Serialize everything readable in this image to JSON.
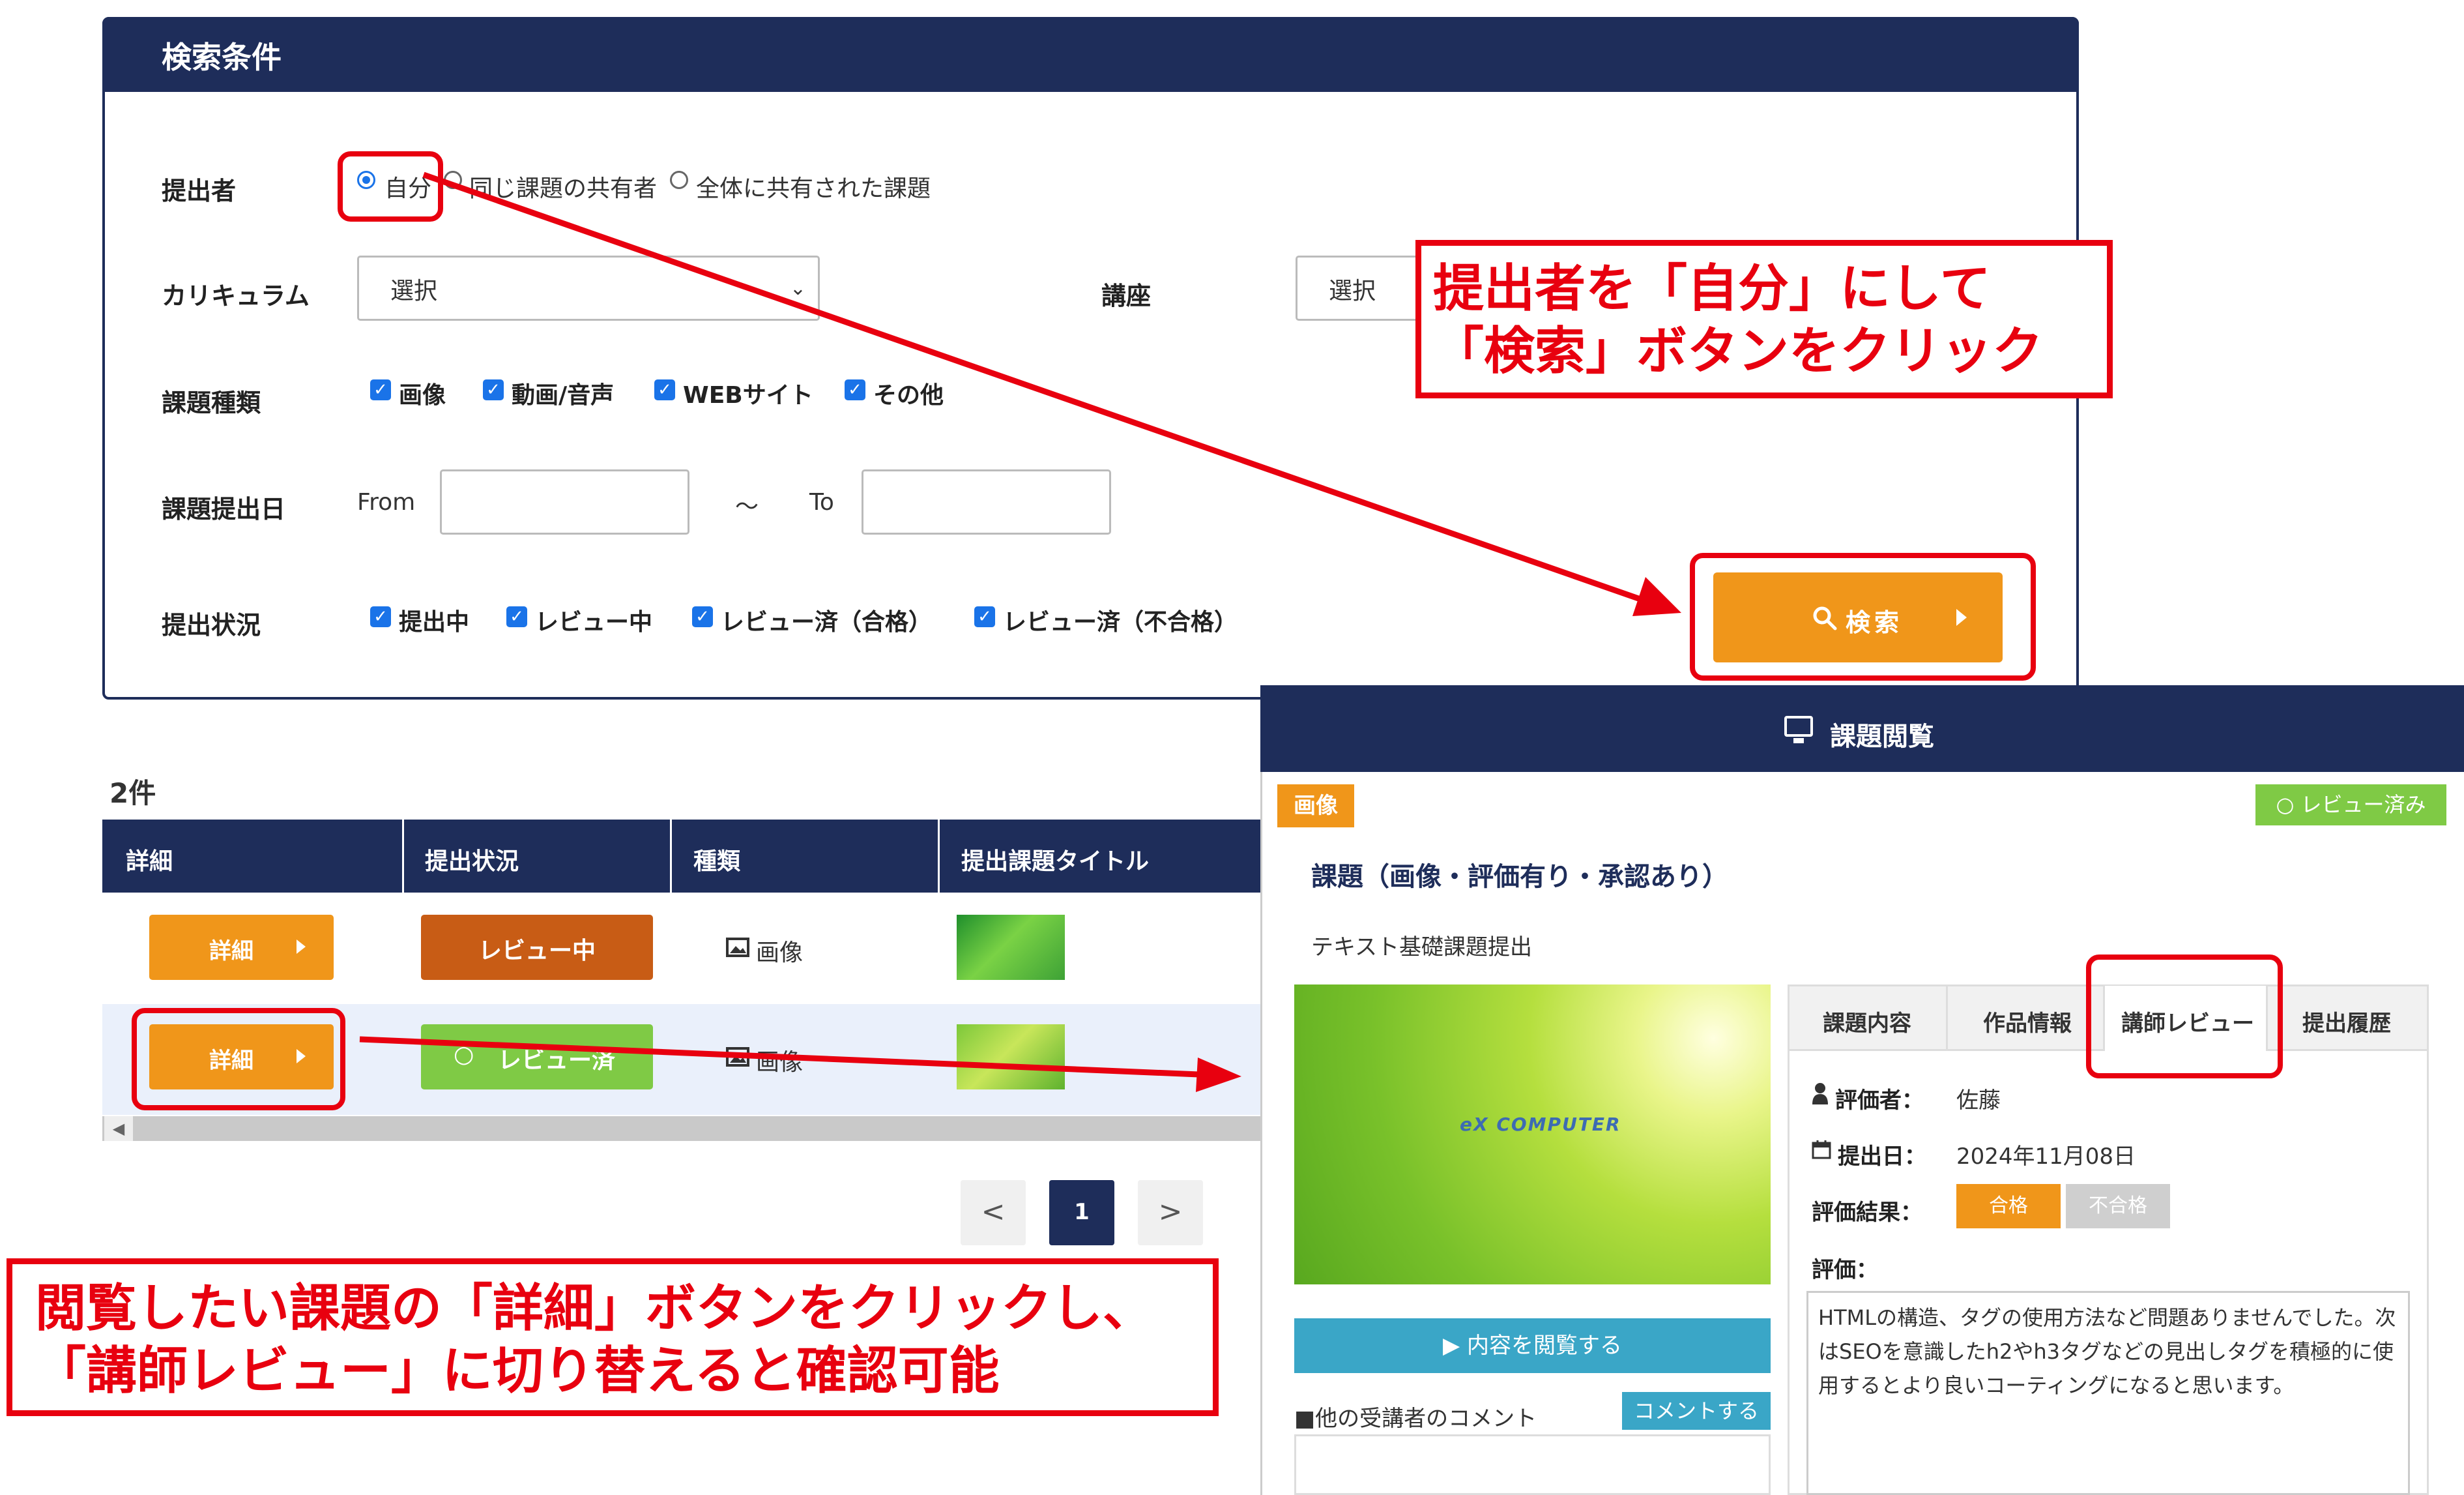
{
  "search_form": {
    "title": "検索条件",
    "submitter": {
      "label": "提出者",
      "options": [
        "自分",
        "同じ課題の共有者",
        "全体に共有された課題"
      ],
      "selected": "自分"
    },
    "curriculum": {
      "label": "カリキュラム",
      "value": "選択"
    },
    "course": {
      "label": "講座",
      "value": "選択"
    },
    "task_type": {
      "label": "課題種類",
      "options": [
        {
          "label": "画像",
          "checked": true
        },
        {
          "label": "動画/音声",
          "checked": true
        },
        {
          "label": "WEBサイト",
          "checked": true
        },
        {
          "label": "その他",
          "checked": true
        }
      ]
    },
    "date": {
      "label": "課題提出日",
      "from_label": "From",
      "tilde": "～",
      "to_label": "To",
      "from_value": "",
      "to_value": ""
    },
    "status": {
      "label": "提出状況",
      "options": [
        {
          "label": "提出中",
          "checked": true
        },
        {
          "label": "レビュー中",
          "checked": true
        },
        {
          "label": "レビュー済（合格）",
          "checked": true
        },
        {
          "label": "レビュー済（不合格）",
          "checked": true
        }
      ]
    },
    "search_button": "検索"
  },
  "results": {
    "count": "2件",
    "columns": [
      "詳細",
      "提出状況",
      "種類",
      "提出課題タイトル"
    ],
    "rows": [
      {
        "detail": "詳細",
        "status": "レビュー中",
        "type": "画像"
      },
      {
        "detail": "詳細",
        "status": "レビュー済",
        "type": "画像"
      }
    ],
    "pagination": {
      "prev": "<",
      "current": "1",
      "next": ">"
    }
  },
  "detail_panel": {
    "header": "課題閲覧",
    "type_badge": "画像",
    "review_badge": "レビュー済み",
    "title": "課題（画像・評価有り・承認あり）",
    "subtitle": "テキスト基礎課題提出",
    "preview_logo": "eX COMPUTER",
    "view_button": "内容を閲覧する",
    "comments_label": "■他の受講者のコメント",
    "comment_button": "コメントする",
    "tabs": [
      "課題内容",
      "作品情報",
      "講師レビュー",
      "提出履歴"
    ],
    "active_tab": "講師レビュー",
    "reviewer_label": "評価者：",
    "reviewer": "佐藤",
    "date_label": "提出日：",
    "date": "2024年11月08日",
    "result_label": "評価結果：",
    "pass": "合格",
    "fail": "不合格",
    "comment_label": "評価：",
    "comment": "HTMLの構造、タグの使用方法など問題ありませんでした。次はSEOを意識したh2やh3タグなどの見出しタグを積極的に使用するとより良いコーティングになると思います。"
  },
  "annotations": {
    "callout1_line1": "提出者を「自分」にして",
    "callout1_line2": "「検索」ボタンをクリック",
    "callout2_line1": "閲覧したい課題の「詳細」ボタンをクリックし、",
    "callout2_line2": "「講師レビュー」に切り替えると確認可能"
  },
  "colors": {
    "navy": "#1e2d5a",
    "orange": "#f0961a",
    "review_in_progress": "#c85c15",
    "reviewed_green": "#7fca45",
    "annotation_red": "#e8000f",
    "view_button_blue": "#3aa6c7"
  }
}
